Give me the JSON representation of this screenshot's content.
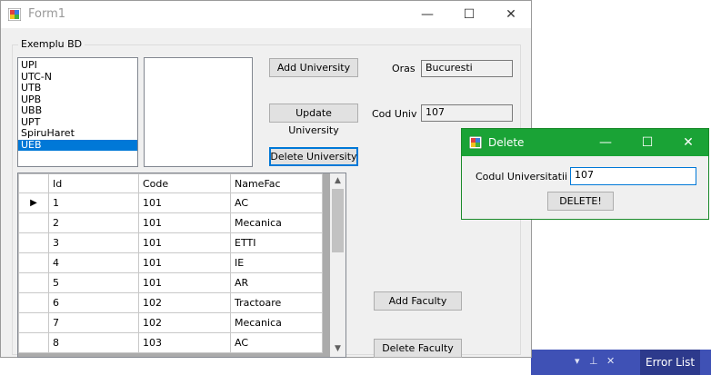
{
  "form": {
    "title": "Form1",
    "group_title": "Exemplu BD",
    "universities": [
      "UPI",
      "UTC-N",
      "UTB",
      "UPB",
      "UBB",
      "UPT",
      "SpiruHaret",
      "UEB"
    ],
    "selected_university": "UEB",
    "buttons": {
      "add_university": "Add University",
      "update_university": "Update University",
      "delete_university": "Delete University",
      "add_faculty": "Add Faculty",
      "delete_faculty": "Delete Faculty"
    },
    "oras_label": "Oras",
    "oras_value": "Bucuresti",
    "cod_label": "Cod Univ",
    "cod_value": "107"
  },
  "grid": {
    "headers": [
      "Id",
      "Code",
      "NameFac"
    ],
    "rows": [
      {
        "id": "1",
        "code": "101",
        "name": "AC"
      },
      {
        "id": "2",
        "code": "101",
        "name": "Mecanica"
      },
      {
        "id": "3",
        "code": "101",
        "name": "ETTI"
      },
      {
        "id": "4",
        "code": "101",
        "name": "IE"
      },
      {
        "id": "5",
        "code": "101",
        "name": "AR"
      },
      {
        "id": "6",
        "code": "102",
        "name": "Tractoare"
      },
      {
        "id": "7",
        "code": "102",
        "name": "Mecanica"
      },
      {
        "id": "8",
        "code": "103",
        "name": "AC"
      }
    ]
  },
  "dialog": {
    "title": "Delete",
    "label": "Codul Universitatii",
    "value": "107",
    "button": "DELETE!"
  },
  "ide": {
    "error_list": "Error List"
  },
  "icons": {
    "minimize": "minimize-icon",
    "maximize": "maximize-icon",
    "close": "close-icon",
    "row_pointer": "row-pointer-icon"
  }
}
